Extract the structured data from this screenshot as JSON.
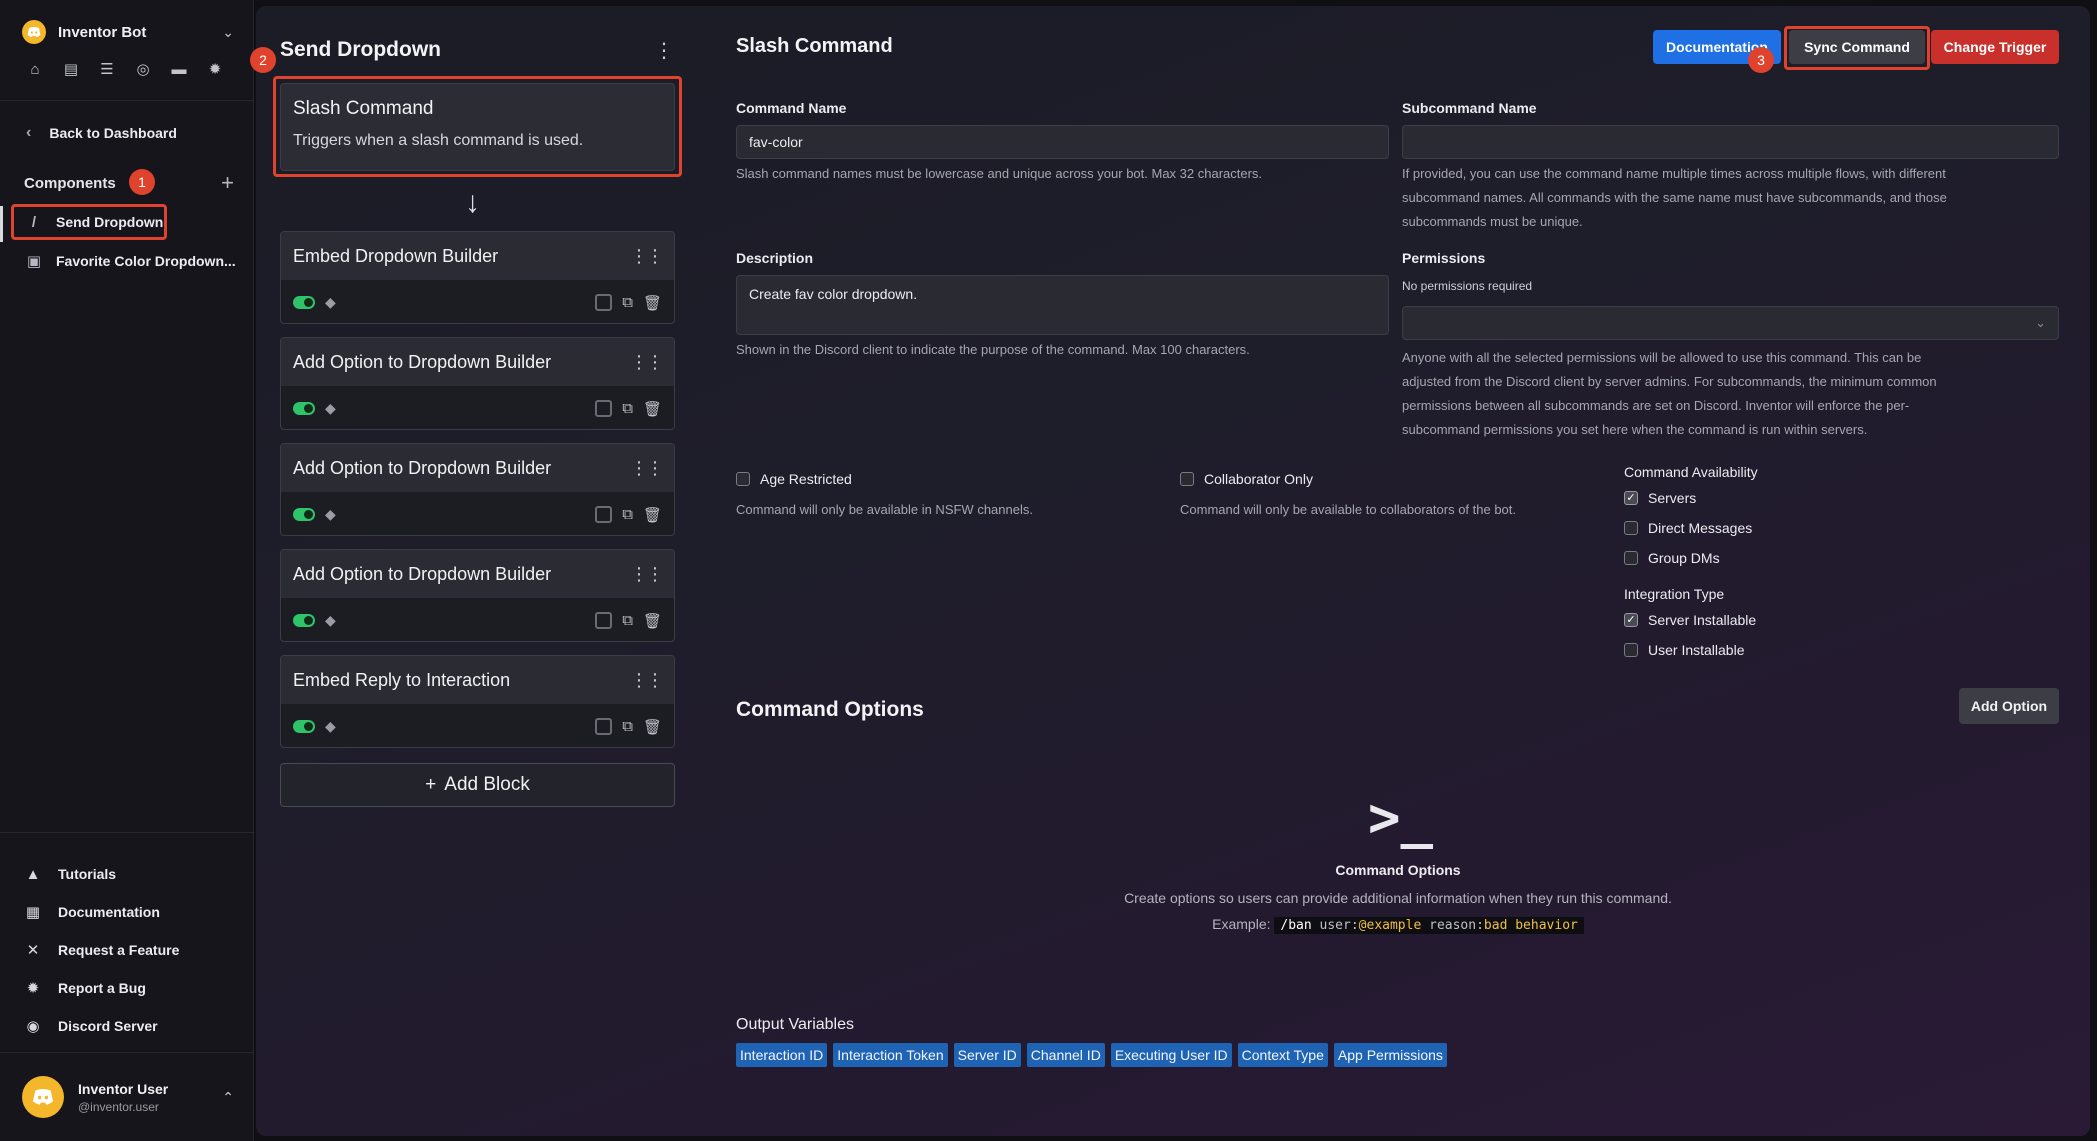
{
  "sidebar": {
    "bot_name": "Inventor Bot",
    "back_label": "Back to Dashboard",
    "components_label": "Components",
    "components": [
      {
        "label": "Send Dropdown",
        "icon": "slash-icon"
      },
      {
        "label": "Favorite Color Dropdown...",
        "icon": "window-icon"
      }
    ],
    "bottom_links": [
      {
        "label": "Tutorials",
        "icon": "graduation-cap-icon"
      },
      {
        "label": "Documentation",
        "icon": "book-icon"
      },
      {
        "label": "Request a Feature",
        "icon": "tools-icon"
      },
      {
        "label": "Report a Bug",
        "icon": "bug-icon"
      },
      {
        "label": "Discord Server",
        "icon": "discord-icon"
      }
    ],
    "user": {
      "name": "Inventor User",
      "handle": "@inventor.user"
    }
  },
  "annotations": {
    "badge1": "1",
    "badge2": "2",
    "badge3": "3"
  },
  "flow": {
    "title": "Send Dropdown",
    "trigger": {
      "title": "Slash Command",
      "subtitle": "Triggers when a slash command is used."
    },
    "blocks": [
      "Embed Dropdown Builder",
      "Add Option to Dropdown Builder",
      "Add Option to Dropdown Builder",
      "Add Option to Dropdown Builder",
      "Embed Reply to Interaction"
    ],
    "add_block_label": "Add Block"
  },
  "form": {
    "title": "Slash Command",
    "buttons": {
      "documentation": "Documentation",
      "sync": "Sync Command",
      "change": "Change Trigger"
    },
    "command_name": {
      "label": "Command Name",
      "value": "fav-color",
      "hint": "Slash command names must be lowercase and unique across your bot. Max 32 characters."
    },
    "subcommand_name": {
      "label": "Subcommand Name",
      "value": "",
      "hint1": "If provided, you can use the command name multiple times across multiple flows, with different",
      "hint2": "subcommand names. All commands with the same name must have subcommands, and those",
      "hint3": "subcommands must be unique."
    },
    "description": {
      "label": "Description",
      "value": "Create fav color dropdown.",
      "hint": "Shown in the Discord client to indicate the purpose of the command. Max 100 characters."
    },
    "permissions": {
      "label": "Permissions",
      "status": "No permissions required",
      "hint1": "Anyone with all the selected permissions will be allowed to use this command. This can be",
      "hint2": "adjusted from the Discord client by server admins. For subcommands, the minimum common",
      "hint3": "permissions between all subcommands are set on Discord. Inventor will enforce the per-",
      "hint4": "subcommand permissions you set here when the command is run within servers."
    },
    "age_restricted": {
      "label": "Age Restricted",
      "hint": "Command will only be available in NSFW channels.",
      "checked": false
    },
    "collaborator_only": {
      "label": "Collaborator Only",
      "hint": "Command will only be available to collaborators of the bot.",
      "checked": false
    },
    "availability": {
      "label": "Command Availability",
      "options": [
        {
          "label": "Servers",
          "checked": true
        },
        {
          "label": "Direct Messages",
          "checked": false
        },
        {
          "label": "Group DMs",
          "checked": false
        }
      ]
    },
    "integration": {
      "label": "Integration Type",
      "options": [
        {
          "label": "Server Installable",
          "checked": true
        },
        {
          "label": "User Installable",
          "checked": false
        }
      ]
    }
  },
  "command_options": {
    "title": "Command Options",
    "add_label": "Add Option",
    "empty_title": "Command Options",
    "empty_desc": "Create options so users can provide additional information when they run this command.",
    "example_label": "Example:",
    "example_cmd": "/ban",
    "example_key1": "user:",
    "example_val1": "@example",
    "example_key2": "reason:",
    "example_val2": "bad behavior"
  },
  "output_variables": {
    "title": "Output Variables",
    "chips": [
      "Interaction ID",
      "Interaction Token",
      "Server ID",
      "Channel ID",
      "Executing User ID",
      "Context Type",
      "App Permissions"
    ]
  }
}
